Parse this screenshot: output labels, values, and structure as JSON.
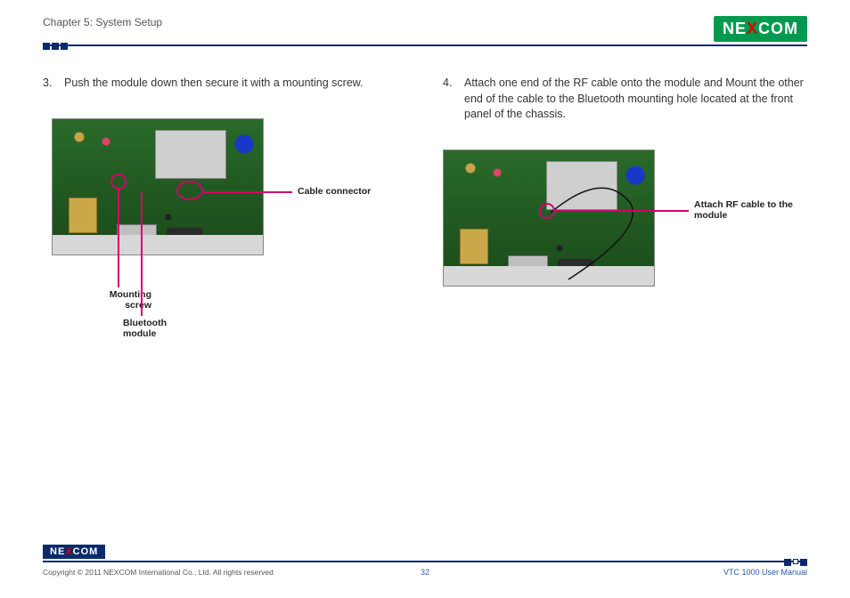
{
  "header": {
    "chapter": "Chapter 5: System Setup",
    "brand_pre": "NE",
    "brand_x": "X",
    "brand_post": "COM"
  },
  "left": {
    "step_num": "3.",
    "step_text": "Push the module down then secure it with a mounting screw.",
    "label_cable": "Cable connector",
    "label_mount": "Mounting screw",
    "label_bt": "Bluetooth module"
  },
  "right": {
    "step_num": "4.",
    "step_text": "Attach one end of the RF cable onto the module and Mount the other end of the cable to the Bluetooth mounting hole located at the front panel of the chassis.",
    "label_rf": "Attach RF cable to the module"
  },
  "footer": {
    "brand_pre": "NE",
    "brand_x": "X",
    "brand_post": "COM",
    "copyright": "Copyright © 2011 NEXCOM International Co., Ltd. All rights reserved",
    "page": "32",
    "manual": "VTC 1000 User Manual"
  }
}
